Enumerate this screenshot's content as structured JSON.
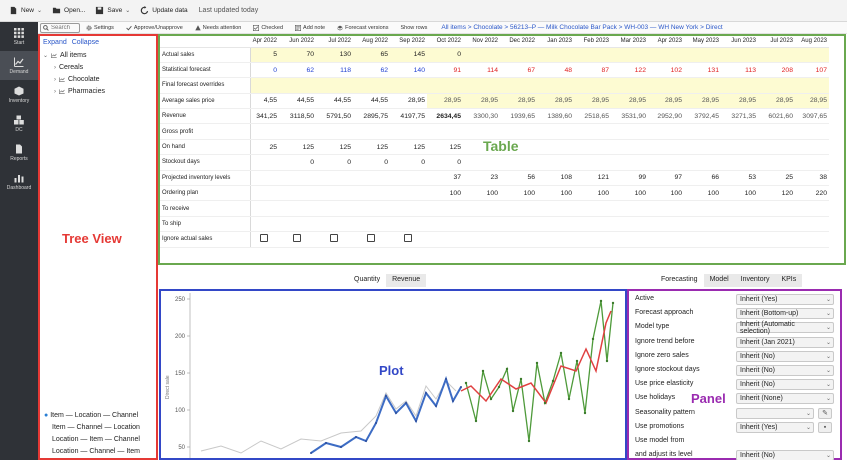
{
  "toolbar": {
    "new_label": "New",
    "open_label": "Open...",
    "save_label": "Save",
    "update_label": "Update data",
    "status": "Last updated today"
  },
  "subbar": {
    "search_placeholder": "Search",
    "buttons": [
      "Settings",
      "Approve/Unapprove",
      "Needs attention",
      "Checked",
      "Add note",
      "Forecast versions",
      "Show rows"
    ],
    "breadcrumb": "All items > Chocolate > 56213–P — Milk Chocolate Bar Pack > WH-003 — WH New York > Direct"
  },
  "leftnav": {
    "items": [
      {
        "label": "Start",
        "icon": "grid-icon"
      },
      {
        "label": "Demand",
        "icon": "chart-line-icon",
        "active": true
      },
      {
        "label": "Inventory",
        "icon": "box-icon"
      },
      {
        "label": "DC",
        "icon": "cubes-icon"
      },
      {
        "label": "Reports",
        "icon": "document-icon"
      },
      {
        "label": "Dashboard",
        "icon": "bar-chart-icon"
      }
    ]
  },
  "tree": {
    "expand_label": "Expand",
    "collapse_label": "Collapse",
    "region_label": "Tree View",
    "nodes": [
      "All items",
      "Cereals",
      "Chocolate",
      "Pharmacies"
    ],
    "hierarchies": [
      "Item — Location — Channel",
      "Item — Channel — Location",
      "Location — Item — Channel",
      "Location — Channel — Item"
    ]
  },
  "table": {
    "region_label": "Table",
    "columns": [
      "Apr 2022",
      "Jun 2022",
      "Jul 2022",
      "Aug 2022",
      "Sep 2022",
      "Oct 2022",
      "Nov 2022",
      "Dec 2022",
      "Jan 2023",
      "Feb 2023",
      "Mar 2023",
      "Apr 2023",
      "May 2023",
      "Jun 2023",
      "Jul 2023",
      "Aug 2023"
    ],
    "rows": [
      {
        "label": "Actual sales",
        "style": "hl",
        "values": [
          "5",
          "70",
          "130",
          "65",
          "145",
          "0",
          "",
          "",
          "",
          "",
          "",
          "",
          "",
          "",
          "",
          ""
        ]
      },
      {
        "label": "Statistical forecast",
        "style": "forecast",
        "values": [
          "0",
          "62",
          "118",
          "62",
          "140",
          "91",
          "114",
          "67",
          "48",
          "87",
          "122",
          "102",
          "131",
          "113",
          "208",
          "107"
        ]
      },
      {
        "label": "Final forecast overrides",
        "style": "override",
        "values": [
          "",
          "",
          "",
          "",
          "",
          "",
          "",
          "",
          "",
          "",
          "",
          "",
          "",
          "",
          "",
          ""
        ]
      },
      {
        "label": "Average sales price",
        "style": "price",
        "values": [
          "4,55",
          "44,55",
          "44,55",
          "44,55",
          "28,95",
          "28,95",
          "28,95",
          "28,95",
          "28,95",
          "28,95",
          "28,95",
          "28,95",
          "28,95",
          "28,95",
          "28,95",
          "28,95"
        ]
      },
      {
        "label": "Revenue",
        "style": "revenue",
        "values": [
          "341,25",
          "3118,50",
          "5791,50",
          "2895,75",
          "4197,75",
          "2634,45",
          "3300,30",
          "1939,65",
          "1389,60",
          "2518,65",
          "3531,90",
          "2952,90",
          "3792,45",
          "3271,35",
          "6021,60",
          "3097,65"
        ]
      },
      {
        "label": "Gross profit",
        "style": "plain",
        "values": [
          "",
          "",
          "",
          "",
          "",
          "",
          "",
          "",
          "",
          "",
          "",
          "",
          "",
          "",
          "",
          ""
        ]
      },
      {
        "label": "On hand",
        "style": "plain",
        "values": [
          "25",
          "125",
          "125",
          "125",
          "125",
          "125",
          "",
          "",
          "",
          "",
          "",
          "",
          "",
          "",
          "",
          ""
        ]
      },
      {
        "label": "Stockout days",
        "style": "plain",
        "values": [
          "",
          "0",
          "0",
          "0",
          "0",
          "0",
          "",
          "",
          "",
          "",
          "",
          "",
          "",
          "",
          "",
          ""
        ]
      },
      {
        "label": "Projected inventory levels",
        "style": "plain",
        "values": [
          "",
          "",
          "",
          "",
          "",
          "37",
          "23",
          "56",
          "108",
          "121",
          "99",
          "97",
          "66",
          "53",
          "25",
          "38"
        ]
      },
      {
        "label": "Ordering plan",
        "style": "plain",
        "values": [
          "",
          "",
          "",
          "",
          "",
          "100",
          "100",
          "100",
          "100",
          "100",
          "100",
          "100",
          "100",
          "100",
          "120",
          "220"
        ]
      },
      {
        "label": "To receive",
        "style": "plain",
        "values": [
          "",
          "",
          "",
          "",
          "",
          "",
          "",
          "",
          "",
          "",
          "",
          "",
          "",
          "",
          "",
          ""
        ]
      },
      {
        "label": "To ship",
        "style": "plain",
        "values": [
          "",
          "",
          "",
          "",
          "",
          "",
          "",
          "",
          "",
          "",
          "",
          "",
          "",
          "",
          "",
          ""
        ]
      },
      {
        "label": "Ignore actual sales",
        "style": "checkbox",
        "values": [
          true,
          true,
          true,
          true,
          true,
          false,
          false,
          false,
          false,
          false,
          false,
          false,
          false,
          false,
          false,
          false
        ]
      }
    ]
  },
  "plot": {
    "region_label": "Plot",
    "tabs": [
      "Quantity",
      "Revenue"
    ],
    "active_tab": "Quantity",
    "ylabel": "Direct sale",
    "yticks": [
      "250",
      "200",
      "150",
      "100",
      "50"
    ]
  },
  "panel": {
    "region_label": "Panel",
    "tabs": [
      "Forecasting",
      "Model",
      "Inventory",
      "KPIs"
    ],
    "active_tab": "Forecasting",
    "settings": [
      {
        "label": "Active",
        "value": "Inherit (Yes)"
      },
      {
        "label": "Forecast approach",
        "value": "Inherit (Bottom-up)"
      },
      {
        "label": "Model type",
        "value": "Inherit (Automatic selection)"
      },
      {
        "label": "Ignore trend before",
        "value": "Inherit (Jan 2021)"
      },
      {
        "label": "Ignore zero sales",
        "value": "Inherit (No)"
      },
      {
        "label": "Ignore stockout days",
        "value": "Inherit (No)"
      },
      {
        "label": "Use price elasticity",
        "value": "Inherit (No)"
      },
      {
        "label": "Use holidays",
        "value": "Inherit (None)"
      },
      {
        "label": "Seasonality pattern",
        "value": ""
      },
      {
        "label": "Use promotions",
        "value": "Inherit (Yes)"
      },
      {
        "label": "Use model from",
        "value": ""
      },
      {
        "label": "and adjust its level",
        "value": "Inherit (No)"
      }
    ]
  },
  "colors": {
    "tree_border": "#e53935",
    "table_border": "#6aa84f",
    "plot_border": "#3348c7",
    "panel_border": "#9a2bb0",
    "highlight_row": "#fdfbd2",
    "forecast_blue": "#1f3fd1",
    "forecast_red": "#e02020",
    "link_blue": "#2a57c9"
  }
}
